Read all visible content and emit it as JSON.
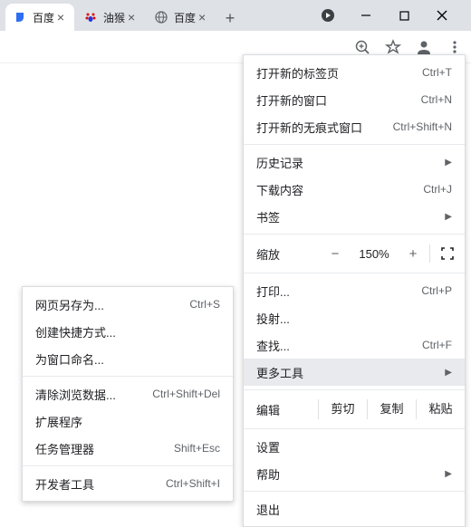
{
  "tabs": [
    {
      "title": "百度",
      "icon": "baidu-blue"
    },
    {
      "title": "油猴",
      "icon": "baidu-paw"
    },
    {
      "title": "百度",
      "icon": "globe"
    }
  ],
  "main_menu": {
    "new_tab": {
      "label": "打开新的标签页",
      "accel": "Ctrl+T"
    },
    "new_window": {
      "label": "打开新的窗口",
      "accel": "Ctrl+N"
    },
    "new_incognito": {
      "label": "打开新的无痕式窗口",
      "accel": "Ctrl+Shift+N"
    },
    "history": {
      "label": "历史记录"
    },
    "downloads": {
      "label": "下载内容",
      "accel": "Ctrl+J"
    },
    "bookmarks": {
      "label": "书签"
    },
    "zoom": {
      "label": "缩放",
      "value": "150%"
    },
    "print": {
      "label": "打印...",
      "accel": "Ctrl+P"
    },
    "cast": {
      "label": "投射..."
    },
    "find": {
      "label": "查找...",
      "accel": "Ctrl+F"
    },
    "more_tools": {
      "label": "更多工具"
    },
    "edit": {
      "label": "编辑",
      "cut": "剪切",
      "copy": "复制",
      "paste": "粘贴"
    },
    "settings": {
      "label": "设置"
    },
    "help": {
      "label": "帮助"
    },
    "exit": {
      "label": "退出"
    }
  },
  "sub_menu": {
    "save_as": {
      "label": "网页另存为...",
      "accel": "Ctrl+S"
    },
    "create_shortcut": {
      "label": "创建快捷方式..."
    },
    "name_window": {
      "label": "为窗口命名..."
    },
    "clear_data": {
      "label": "清除浏览数据...",
      "accel": "Ctrl+Shift+Del"
    },
    "extensions": {
      "label": "扩展程序"
    },
    "task_manager": {
      "label": "任务管理器",
      "accel": "Shift+Esc"
    },
    "dev_tools": {
      "label": "开发者工具",
      "accel": "Ctrl+Shift+I"
    }
  }
}
